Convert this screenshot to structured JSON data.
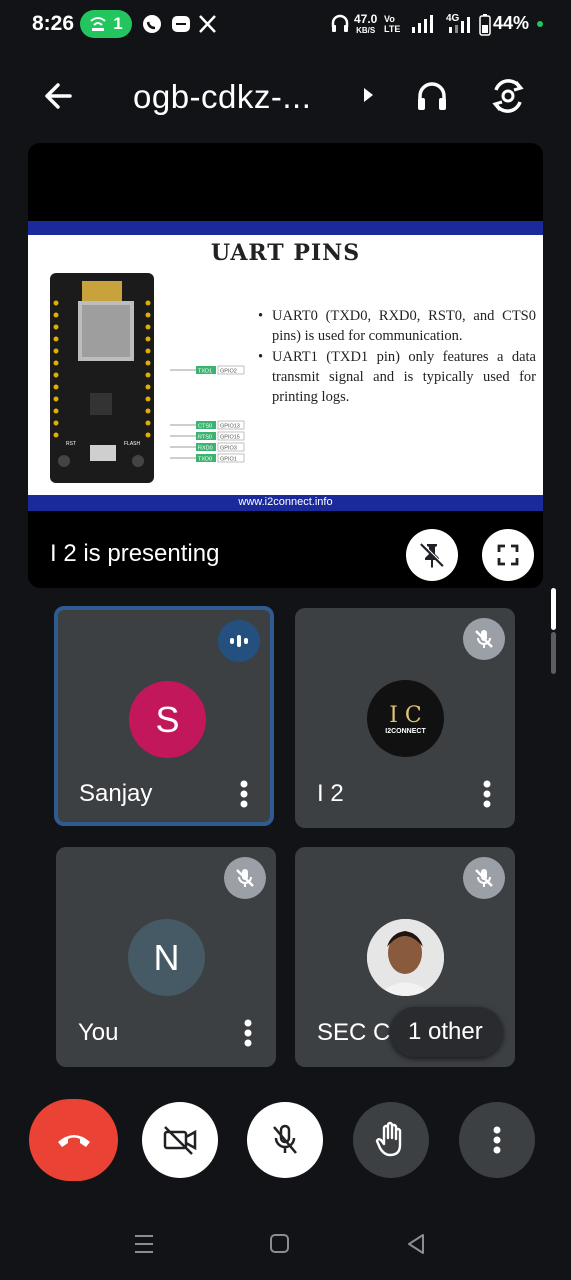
{
  "status_bar": {
    "time": "8:26",
    "hotspot_count": "1",
    "net_speed_value": "47.0",
    "net_speed_unit": "KB/S",
    "volte_line1": "Vo",
    "volte_line2": "LTE",
    "network_type": "4G",
    "battery": "44%",
    "colors": {
      "hotspot": "#22c55e",
      "dot": "#22c55e"
    },
    "icons": [
      "hotspot-icon",
      "whatsapp-icon",
      "message-icon",
      "x-icon",
      "headphones-icon",
      "signal-icon",
      "battery-icon"
    ]
  },
  "top_bar": {
    "meeting_code": "ogb-cdkz-...",
    "icons": [
      "back-arrow-icon",
      "caret-right-icon",
      "headphones-icon",
      "switch-camera-icon"
    ]
  },
  "presentation": {
    "slide_title": "UART PINS",
    "bullets": [
      "UART0 (TXD0, RXD0, RST0, and CTS0 pins) is used for communication.",
      "UART1 (TXD1 pin) only features a data transmit signal and is typically used for printing logs."
    ],
    "pin_labels": [
      {
        "name": "TXD1",
        "gpio": "GPIO2"
      },
      {
        "name": "CTS0",
        "gpio": "GPIO13"
      },
      {
        "name": "RTS0",
        "gpio": "GPIO15"
      },
      {
        "name": "RXD0",
        "gpio": "GPIO3"
      },
      {
        "name": "TXD0",
        "gpio": "GPIO1"
      }
    ],
    "board_labels": {
      "rst": "RST",
      "flash": "FLASH"
    },
    "footer_url": "www.i2connect.info",
    "presenting_text": "I 2 is presenting",
    "accent_color": "#1a2a9b"
  },
  "participants": [
    {
      "name": "Sanjay",
      "initial": "S",
      "avatar_color": "#c2185b",
      "status": "speaking"
    },
    {
      "name": "I 2",
      "logo_text": "I C",
      "logo_sub": "I2CONNECT",
      "status": "muted"
    },
    {
      "name": "You",
      "initial": "N",
      "avatar_color": "#455a64",
      "status": "muted"
    },
    {
      "name": "SEC C S",
      "status": "muted",
      "has_photo": true
    }
  ],
  "other_chip": "1 other",
  "controls": {
    "end_call_color": "#ea4335",
    "buttons": [
      "end-call-icon",
      "camera-off-icon",
      "mic-off-icon",
      "raise-hand-icon",
      "more-options-icon"
    ]
  }
}
